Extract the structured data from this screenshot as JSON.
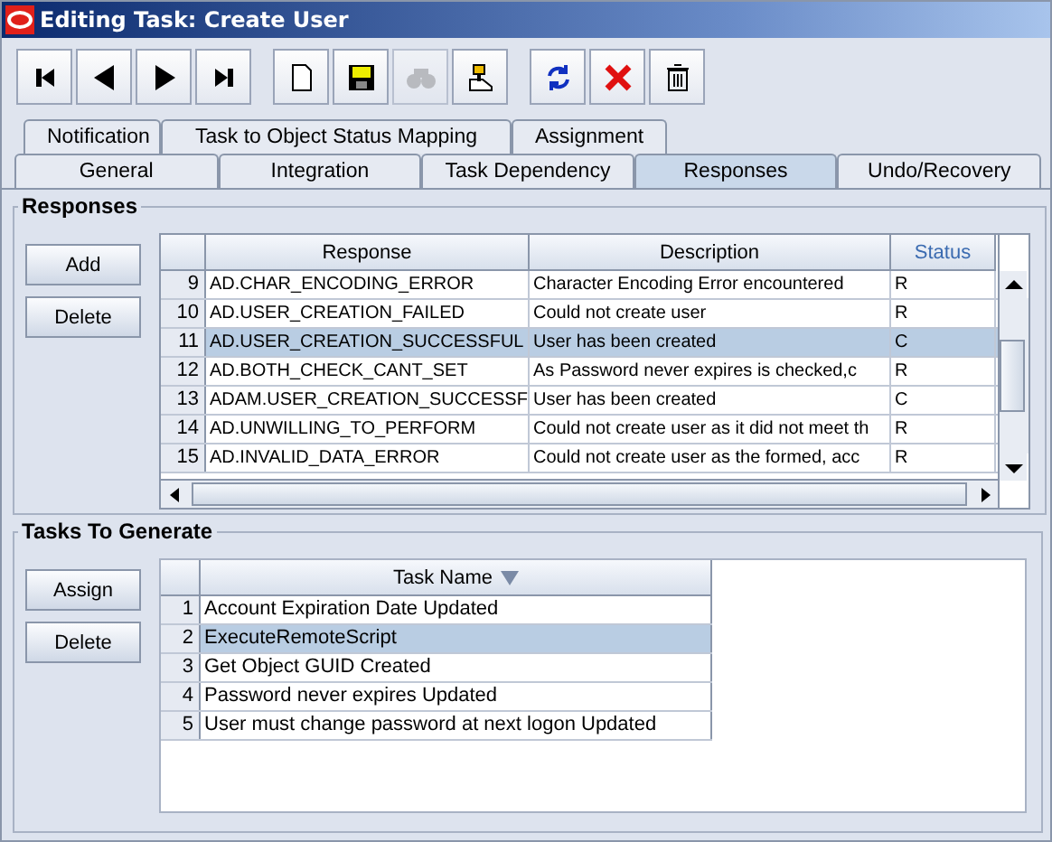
{
  "window": {
    "title": "Editing Task: Create User"
  },
  "toolbar": [
    {
      "kind": "first",
      "disabled": false
    },
    {
      "kind": "previous",
      "disabled": false
    },
    {
      "kind": "next",
      "disabled": false
    },
    {
      "kind": "last",
      "disabled": false
    },
    {
      "kind": "new",
      "disabled": false
    },
    {
      "kind": "save",
      "disabled": false
    },
    {
      "kind": "find",
      "disabled": true
    },
    {
      "kind": "pin",
      "disabled": false
    },
    {
      "kind": "refresh",
      "disabled": false
    },
    {
      "kind": "cancel",
      "disabled": false
    },
    {
      "kind": "delete",
      "disabled": false
    }
  ],
  "tab_rows": [
    [
      {
        "label": "Notification",
        "selected": false
      },
      {
        "label": "Task to Object Status Mapping",
        "selected": false
      },
      {
        "label": "Assignment",
        "selected": false
      }
    ],
    [
      {
        "label": "General",
        "selected": false
      },
      {
        "label": "Integration",
        "selected": false
      },
      {
        "label": "Task Dependency",
        "selected": false
      },
      {
        "label": "Responses",
        "selected": true
      },
      {
        "label": "Undo/Recovery",
        "selected": false
      }
    ]
  ],
  "responses": {
    "title": "Responses",
    "buttons": [
      "Add",
      "Delete"
    ],
    "columns": [
      {
        "label": "Response",
        "highlighted": false
      },
      {
        "label": "Description",
        "highlighted": false
      },
      {
        "label": "Status",
        "highlighted": true
      }
    ],
    "rows": [
      {
        "number": "9",
        "response": "AD.CHAR_ENCODING_ERROR",
        "description": "Character Encoding Error encountered",
        "status": "R",
        "selected": false
      },
      {
        "number": "10",
        "response": "AD.USER_CREATION_FAILED",
        "description": "Could not create user",
        "status": "R",
        "selected": false
      },
      {
        "number": "11",
        "response": "AD.USER_CREATION_SUCCESSFUL",
        "description": "User has been created",
        "status": "C",
        "selected": true
      },
      {
        "number": "12",
        "response": "AD.BOTH_CHECK_CANT_SET",
        "description": "As Password never expires is checked,c",
        "status": "R",
        "selected": false
      },
      {
        "number": "13",
        "response": "ADAM.USER_CREATION_SUCCESSF",
        "description": "User has been created",
        "status": "C",
        "selected": false
      },
      {
        "number": "14",
        "response": "AD.UNWILLING_TO_PERFORM",
        "description": "Could not create user as it did not meet th",
        "status": "R",
        "selected": false
      },
      {
        "number": "15",
        "response": "AD.INVALID_DATA_ERROR",
        "description": "Could not create user as the formed, acc",
        "status": "R",
        "selected": false
      }
    ]
  },
  "tasks_to_generate": {
    "title": "Tasks To Generate",
    "buttons": [
      "Assign",
      "Delete"
    ],
    "column": {
      "label": "Task Name",
      "sort_indicator": true
    },
    "rows": [
      {
        "number": "1",
        "name": "Account Expiration Date Updated",
        "selected": false
      },
      {
        "number": "2",
        "name": "ExecuteRemoteScript",
        "selected": true
      },
      {
        "number": "3",
        "name": "Get Object GUID Created",
        "selected": false
      },
      {
        "number": "4",
        "name": "Password never expires Updated",
        "selected": false
      },
      {
        "number": "5",
        "name": "User must change password at next logon Updated",
        "selected": false
      }
    ]
  }
}
